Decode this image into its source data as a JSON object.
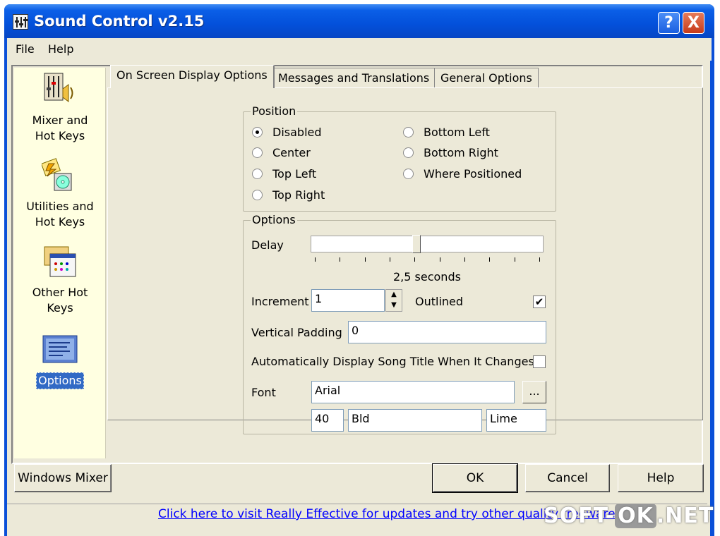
{
  "window": {
    "title": "Sound Control v2.15",
    "help_button": "?",
    "close_button": "X"
  },
  "menu": {
    "items": [
      "File",
      "Help"
    ]
  },
  "sidebar": {
    "items": [
      {
        "label": "Mixer and Hot Keys",
        "icon": "mixer-icon",
        "selected": false
      },
      {
        "label": "Utilities and Hot Keys",
        "icon": "utilities-icon",
        "selected": false
      },
      {
        "label": "Other Hot Keys",
        "icon": "other-hotkeys-icon",
        "selected": false
      },
      {
        "label": "Options",
        "icon": "options-icon",
        "selected": true
      }
    ]
  },
  "tabs": [
    {
      "label": "On Screen Display Options",
      "active": true
    },
    {
      "label": "Messages and Translations",
      "active": false
    },
    {
      "label": "General Options",
      "active": false
    }
  ],
  "position_group": {
    "title": "Position",
    "options": [
      {
        "label": "Disabled",
        "checked": true
      },
      {
        "label": "Center",
        "checked": false
      },
      {
        "label": "Top Left",
        "checked": false
      },
      {
        "label": "Top Right",
        "checked": false
      },
      {
        "label": "Bottom Left",
        "checked": false
      },
      {
        "label": "Bottom Right",
        "checked": false
      },
      {
        "label": "Where Positioned",
        "checked": false
      }
    ]
  },
  "options_group": {
    "title": "Options",
    "delay_label": "Delay",
    "delay_value_text": "2,5 seconds",
    "delay_slider_fraction": 0.45,
    "increment_label": "Increment",
    "increment_value": "1",
    "spin_up": "▲",
    "spin_down": "▼",
    "outlined_label": "Outlined",
    "outlined_checked": true,
    "check_mark": "✔",
    "vertical_padding_label": "Vertical Padding",
    "vertical_padding_value": "0",
    "auto_display_label": "Automatically Display Song Title When It Changes",
    "auto_display_checked": false,
    "font_label": "Font",
    "font_name": "Arial",
    "font_browse": "...",
    "font_size": "40",
    "font_style": "Bld",
    "font_color": "Lime"
  },
  "buttons": {
    "windows_mixer": "Windows Mixer",
    "ok": "OK",
    "cancel": "Cancel",
    "help": "Help"
  },
  "status": {
    "link_text": "Click here to visit Really Effective for updates and try other quality freeware"
  },
  "watermark": {
    "part1": "SOFT-",
    "part2": "OK",
    "part3": ".NET"
  },
  "colors": {
    "titlebar": "#0350da",
    "sidebar_bg": "#ffffe1",
    "selection": "#316ac5",
    "link": "#0000ff"
  }
}
